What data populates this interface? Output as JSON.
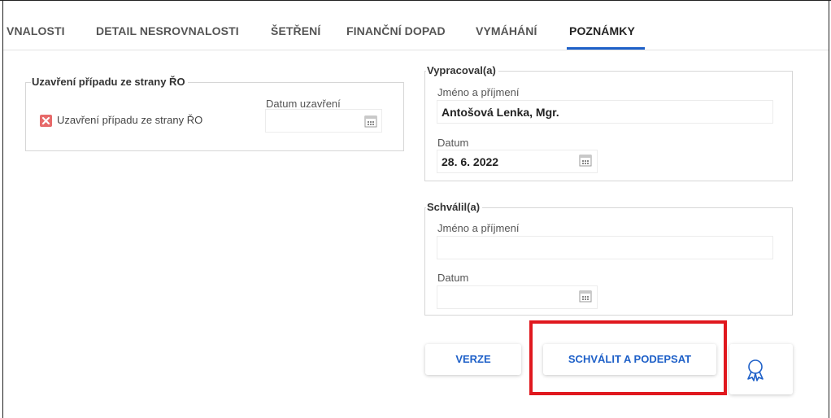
{
  "tabs": [
    {
      "label": "VNALOSTI",
      "active": false
    },
    {
      "label": "DETAIL NESROVNALOSTI",
      "active": false
    },
    {
      "label": "ŠETŘENÍ",
      "active": false
    },
    {
      "label": "FINANČNÍ DOPAD",
      "active": false
    },
    {
      "label": "VYMÁHÁNÍ",
      "active": false
    },
    {
      "label": "POZNÁMKY",
      "active": true
    }
  ],
  "closure": {
    "legend": "Uzavření případu ze strany ŘO",
    "checkbox_label": "Uzavření případu ze strany ŘO",
    "checkbox_checked": false,
    "date_label": "Datum uzavření",
    "date_value": ""
  },
  "prepared": {
    "legend": "Vypracoval(a)",
    "name_label": "Jméno a příjmení",
    "name_value": "Antošová Lenka, Mgr.",
    "date_label": "Datum",
    "date_value": "28. 6. 2022"
  },
  "approved": {
    "legend": "Schválil(a)",
    "name_label": "Jméno a příjmení",
    "name_value": "",
    "date_label": "Datum",
    "date_value": ""
  },
  "buttons": {
    "versions": "VERZE",
    "approve_sign": "SCHVÁLIT A PODEPSAT"
  },
  "colors": {
    "accent": "#1e60c8",
    "highlight": "#e0181e",
    "unchecked_box": "#e76a6a"
  },
  "icons": [
    "calendar-icon",
    "close-icon",
    "award-ribbon-icon"
  ]
}
